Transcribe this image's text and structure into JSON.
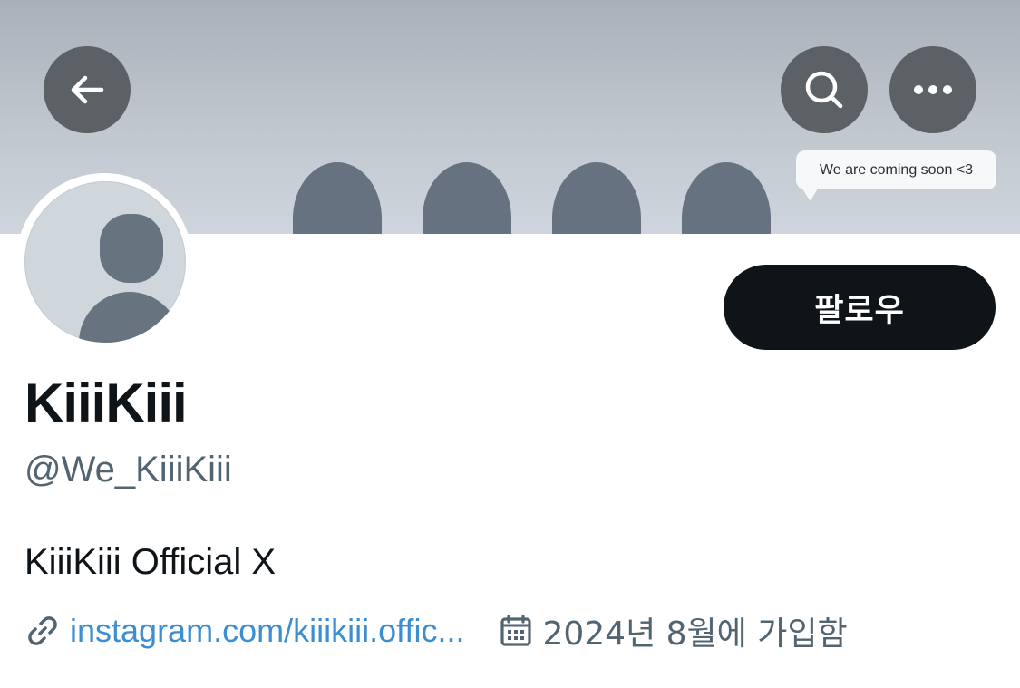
{
  "header": {
    "back_icon": "arrow-left-icon",
    "search_icon": "search-icon",
    "more_icon": "more-horizontal-icon",
    "banner_note": "We are coming soon <3"
  },
  "profile": {
    "follow_label": "팔로우",
    "display_name": "KiiiKiii",
    "handle": "@We_KiiiKiii",
    "bio": "KiiiKiii Official X",
    "link_text": "instagram.com/kiiikiii.offic...",
    "link_icon": "link-icon",
    "calendar_icon": "calendar-icon",
    "joined": "2024년 8월에 가입함"
  },
  "colors": {
    "follow_button_bg": "#0f1419",
    "link": "#3b8ed1",
    "secondary_text": "#536471"
  }
}
